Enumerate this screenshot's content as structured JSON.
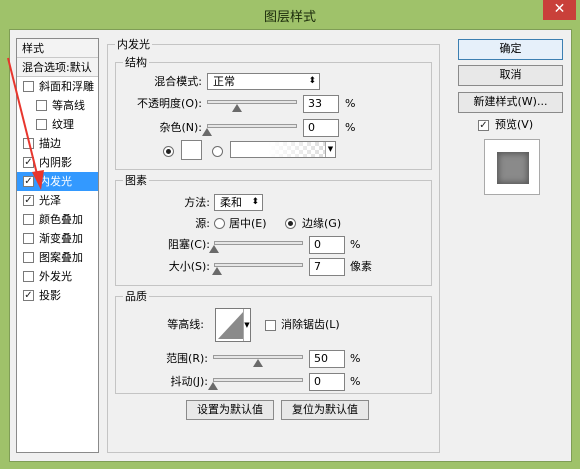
{
  "window": {
    "title": "图层样式",
    "close_glyph": "✕"
  },
  "left_panel": {
    "header_styles": "样式",
    "header_blending": "混合选项:默认",
    "items": [
      {
        "label": "斜面和浮雕",
        "checked": false,
        "indent": false
      },
      {
        "label": "等高线",
        "checked": false,
        "indent": true
      },
      {
        "label": "纹理",
        "checked": false,
        "indent": true
      },
      {
        "label": "描边",
        "checked": false,
        "indent": false
      },
      {
        "label": "内阴影",
        "checked": true,
        "indent": false
      },
      {
        "label": "内发光",
        "checked": true,
        "indent": false,
        "selected": true
      },
      {
        "label": "光泽",
        "checked": true,
        "indent": false
      },
      {
        "label": "颜色叠加",
        "checked": false,
        "indent": false
      },
      {
        "label": "渐变叠加",
        "checked": false,
        "indent": false
      },
      {
        "label": "图案叠加",
        "checked": false,
        "indent": false
      },
      {
        "label": "外发光",
        "checked": false,
        "indent": false
      },
      {
        "label": "投影",
        "checked": true,
        "indent": false
      }
    ]
  },
  "inner_glow": {
    "title": "内发光",
    "structure": {
      "title": "结构",
      "blend_mode_label": "混合模式:",
      "blend_mode_value": "正常",
      "opacity_label": "不透明度(O):",
      "opacity_value": "33",
      "opacity_unit": "%",
      "opacity_level": 0.33,
      "noise_label": "杂色(N):",
      "noise_value": "0",
      "noise_unit": "%",
      "noise_level": 0,
      "color_radio_selected": true,
      "gradient_radio_selected": false
    },
    "elements": {
      "title": "图素",
      "method_label": "方法:",
      "method_value": "柔和",
      "source_label": "源:",
      "source_center": "居中(E)",
      "source_edge": "边缘(G)",
      "source_selected": "edge",
      "choke_label": "阻塞(C):",
      "choke_value": "0",
      "choke_unit": "%",
      "choke_level": 0,
      "size_label": "大小(S):",
      "size_value": "7",
      "size_unit": "像素",
      "size_level": 0.03
    },
    "quality": {
      "title": "品质",
      "contour_label": "等高线:",
      "anti_alias_label": "消除锯齿(L)",
      "anti_alias_checked": false,
      "range_label": "范围(R):",
      "range_value": "50",
      "range_unit": "%",
      "range_level": 0.5,
      "jitter_label": "抖动(J):",
      "jitter_value": "0",
      "jitter_unit": "%",
      "jitter_level": 0
    },
    "make_default": "设置为默认值",
    "reset_default": "复位为默认值"
  },
  "right_buttons": {
    "ok": "确定",
    "cancel": "取消",
    "new_style": "新建样式(W)...",
    "preview_label": "预览(V)",
    "preview_checked": true
  },
  "colors": {
    "window_frame": "#9fc26a",
    "selection": "#3399ff",
    "annotation_arrow": "#e8362d"
  }
}
